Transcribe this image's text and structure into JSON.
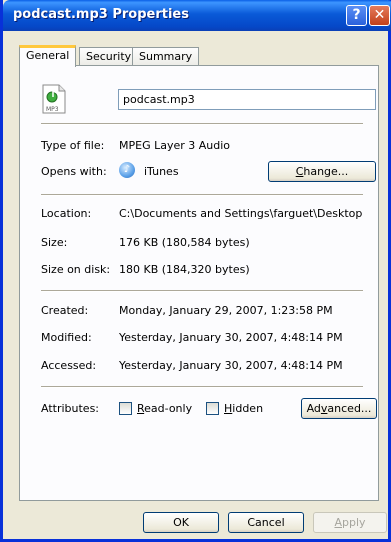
{
  "window": {
    "title": "podcast.mp3 Properties"
  },
  "titlebar": {
    "help_glyph": "?",
    "close_glyph": "✕"
  },
  "tabs": [
    {
      "label": "General"
    },
    {
      "label": "Security"
    },
    {
      "label": "Summary"
    }
  ],
  "file": {
    "icon_label": "MP3",
    "name": "podcast.mp3"
  },
  "type_of_file": {
    "label": "Type of file:",
    "value": "MPEG Layer 3 Audio"
  },
  "opens_with": {
    "label": "Opens with:",
    "app": "iTunes",
    "change_pre": "C",
    "change_rest": "hange..."
  },
  "location": {
    "label": "Location:",
    "value": "C:\\Documents and Settings\\farguet\\Desktop"
  },
  "size": {
    "label": "Size:",
    "value": "176 KB (180,584 bytes)"
  },
  "size_on_disk": {
    "label": "Size on disk:",
    "value": "180 KB (184,320 bytes)"
  },
  "created": {
    "label": "Created:",
    "value": "Monday, January 29, 2007, 1:23:58 PM"
  },
  "modified": {
    "label": "Modified:",
    "value": "Yesterday, January 30, 2007, 4:48:14 PM"
  },
  "accessed": {
    "label": "Accessed:",
    "value": "Yesterday, January 30, 2007, 4:48:14 PM"
  },
  "attributes": {
    "label": "Attributes:",
    "readonly_pre": "R",
    "readonly_rest": "ead-only",
    "readonly_checked": false,
    "hidden_pre": "H",
    "hidden_rest": "idden",
    "hidden_checked": false,
    "advanced_pre": "Ad",
    "advanced_u": "v",
    "advanced_rest": "anced..."
  },
  "buttons": {
    "ok": "OK",
    "cancel": "Cancel",
    "apply_pre": "A",
    "apply_rest": "pply"
  }
}
